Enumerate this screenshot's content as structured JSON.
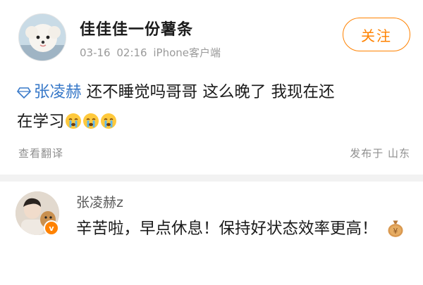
{
  "post": {
    "username": "佳佳佳一份薯条",
    "date": "03-16 02:16",
    "source": "iPhone客户端",
    "follow_label": "关注",
    "mention": "张凌赫",
    "content_line1": " 还不睡觉吗哥哥 这么晚了 我现在还",
    "content_line2": "在学习",
    "translate_label": "查看翻译",
    "location": "发布于 山东"
  },
  "reply": {
    "username": "张凌赫z",
    "text": "辛苦啦，早点休息！保持好状态效率更高！",
    "verified_badge": "v"
  },
  "icons": {
    "mention_icon": "diamond-icon",
    "emoji": "crying-face-emoji",
    "reply_emoji": "money-bag-emoji"
  },
  "colors": {
    "accent": "#ff8200",
    "mention": "#3778c8",
    "meta": "#9a9a9a"
  }
}
